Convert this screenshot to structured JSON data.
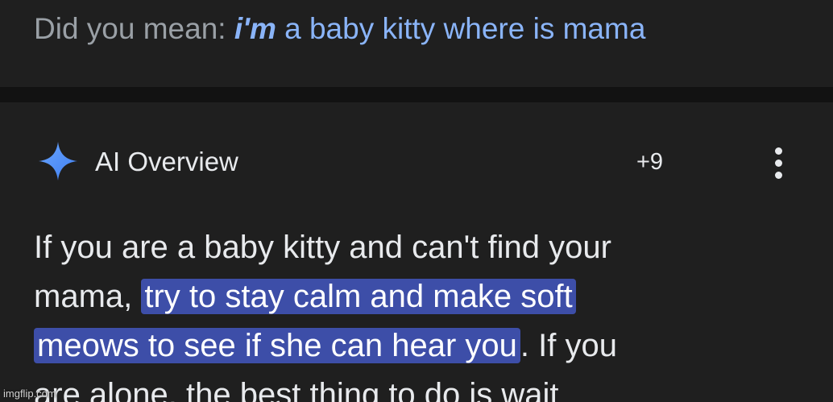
{
  "did_you_mean": {
    "label": "Did you mean:",
    "suggestion_bold": "i'm",
    "suggestion_rest": "a baby kitty where is mama"
  },
  "ai_overview": {
    "icon": "sparkle-icon",
    "title": "AI Overview",
    "source_count": "+9",
    "more_icon": "more-vert-icon",
    "body": {
      "line1": "If you are a baby kitty and can't find your",
      "line2_prefix": "mama,",
      "line2_highlight": "try to stay calm and make soft",
      "line3_highlight": "meows to see if she can hear you",
      "line3_suffix": ". If you",
      "line4": "are alone, the best thing to do is wait"
    }
  },
  "colors": {
    "background": "#1f1f1f",
    "separator": "#121212",
    "link": "#8ab4f8",
    "highlight": "#3d4ea8",
    "text": "#e8eaed",
    "muted": "#9aa0a6"
  },
  "watermark": "imgflip.com"
}
